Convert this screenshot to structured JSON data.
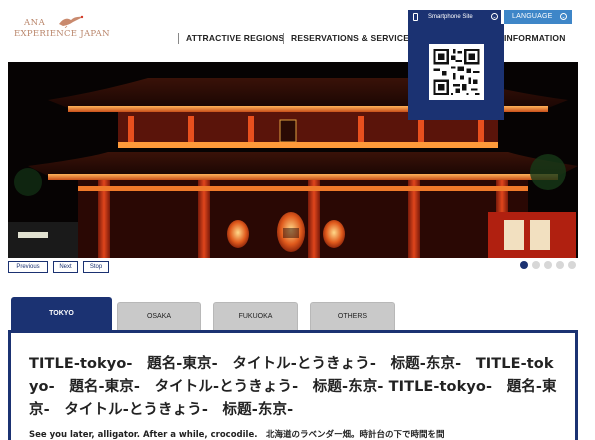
{
  "header": {
    "logo_line1": "ANA",
    "logo_line2": "EXPERIENCE JAPAN",
    "nav": [
      "ATTRACTIVE REGIONS",
      "RESERVATIONS & SERVICES",
      "INFORMATION"
    ],
    "smartphone_label": "Smartphone Site",
    "language_label": "LANGUAGE"
  },
  "slider": {
    "controls": [
      "Previous",
      "Next",
      "Stop"
    ],
    "slide_count": 5,
    "active_slide": 1
  },
  "tabs": [
    "TOKYO",
    "OSAKA",
    "FUKUOKA",
    "OTHERS"
  ],
  "active_tab": "TOKYO",
  "panel": {
    "title": "TITLE-tokyo-　題名-東京-　タイトル-とうきょう-　标题-东京-　TITLE-tokyo-　題名-東京-　タイトル-とうきょう-　标题-东京- TITLE-tokyo-　題名-東京-　タイトル-とうきょう-　标题-东京-",
    "body": "See you later, alligator. After a while, crocodile.　北海道のラベンダー畑。時計台の下で時間を間"
  },
  "colors": {
    "navy": "#1b3272",
    "language_blue": "#3e86c8",
    "tab_grey": "#c9c9c9",
    "logo_gold": "#b9856a"
  },
  "icons": [
    "crane-logo-icon",
    "smartphone-icon",
    "chevron-down-icon",
    "qr-code-icon"
  ]
}
